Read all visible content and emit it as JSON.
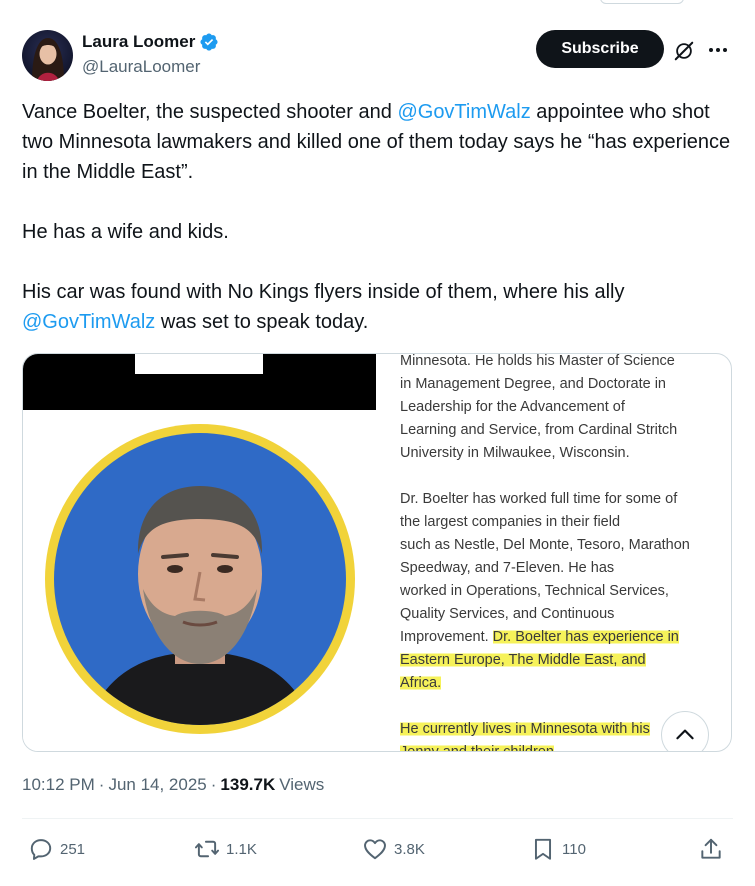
{
  "author": {
    "display_name": "Laura Loomer",
    "handle": "@LauraLoomer",
    "verified": true
  },
  "header": {
    "subscribe_label": "Subscribe",
    "icons": [
      "verified-badge-icon",
      "grok-icon",
      "more-icon"
    ]
  },
  "tweet": {
    "p1_a": "Vance Boelter, the suspected shooter and ",
    "p1_mention": "@GovTimWalz",
    "p1_b": " appointee who shot two Minnesota lawmakers and killed one of them today says he “has experience in the Middle East”.",
    "p2": "He has a wife and kids.",
    "p3_a": "His car was found with No Kings flyers inside of them, where his ally ",
    "p3_mention": "@GovTimWalz",
    "p3_b": " was set to speak today."
  },
  "media": {
    "doc_lines_1": [
      "Minnesota. He holds his Master of Science",
      "in Management Degree, and Doctorate in",
      "Leadership for the Advancement of",
      "Learning and Service, from Cardinal Stritch",
      "University in Milwaukee, Wisconsin."
    ],
    "doc_lines_2": [
      "Dr. Boelter has worked full time for some of",
      "the largest companies in their field",
      "such as Nestle, Del Monte, Tesoro, Marathon",
      "Speedway, and 7-Eleven. He has",
      "worked in Operations, Technical Services,",
      "Quality Services, and Continuous"
    ],
    "doc_line_improvement_a": "Improvement. ",
    "doc_line_improvement_b": "Dr. Boelter has experience in",
    "doc_hl_1": "Eastern Europe, The Middle East, and",
    "doc_hl_2": "Africa.",
    "doc_hl_3": "He currently lives in Minnesota with his",
    "doc_hl_4": "Jenny and their children",
    "highlight_color": "#f6f25a",
    "portrait_ring_color": "#f1d33a",
    "portrait_bg_color": "#2f6ac6"
  },
  "meta": {
    "time": "10:12 PM",
    "sep1": "·",
    "date": "Jun 14, 2025",
    "sep2": "·",
    "views_count": "139.7K",
    "views_label": "Views"
  },
  "actions": {
    "replies": "251",
    "reposts": "1.1K",
    "likes": "3.8K",
    "bookmarks": "110"
  },
  "colors": {
    "link": "#1d9bf0",
    "text": "#0f1419",
    "muted": "#536471",
    "verified": "#1d9bf0"
  }
}
